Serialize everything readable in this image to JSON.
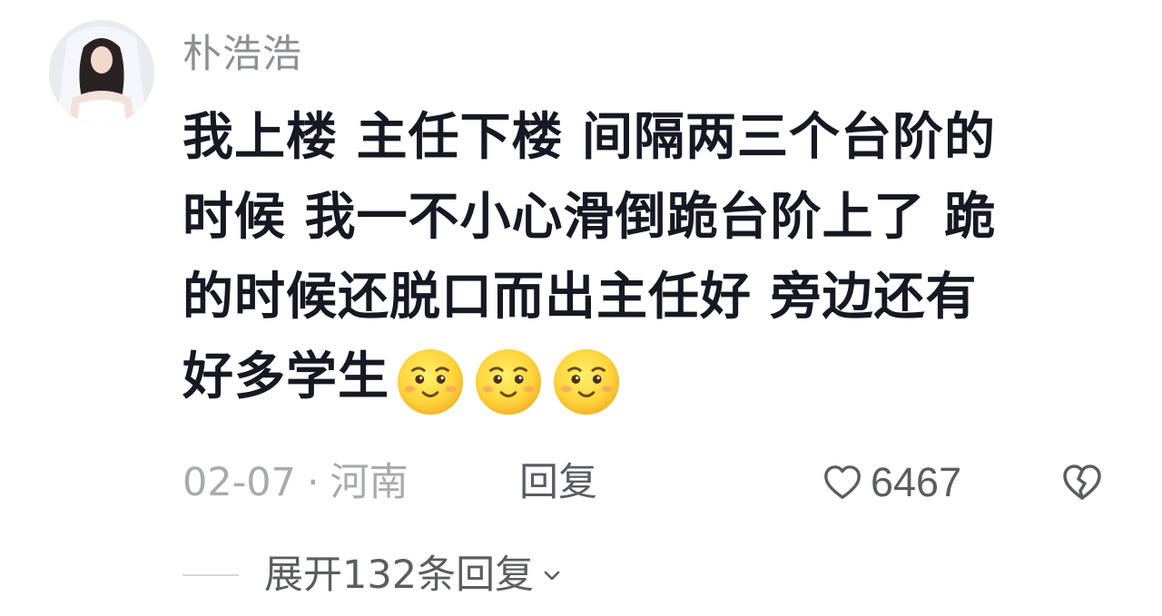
{
  "comment": {
    "username": "朴浩浩",
    "text_lines": [
      "我上楼 主任下楼 间隔两三个台阶的",
      "时候 我一不小心滑倒跪台阶上了 跪",
      "的时候还脱口而出主任好  旁边还有",
      "好多学生"
    ],
    "emojis": [
      "smirk-face-icon",
      "smirk-face-icon",
      "smirk-face-icon"
    ],
    "date": "02-07",
    "separator": "·",
    "location": "河南",
    "reply_label": "回复",
    "like_count": "6467",
    "expand_replies_label": "展开132条回复"
  },
  "colors": {
    "username": "#8d8f93",
    "text": "#161823",
    "meta": "#a8aaae",
    "action": "#5b5d61",
    "emoji_face": "#ffd43b"
  }
}
